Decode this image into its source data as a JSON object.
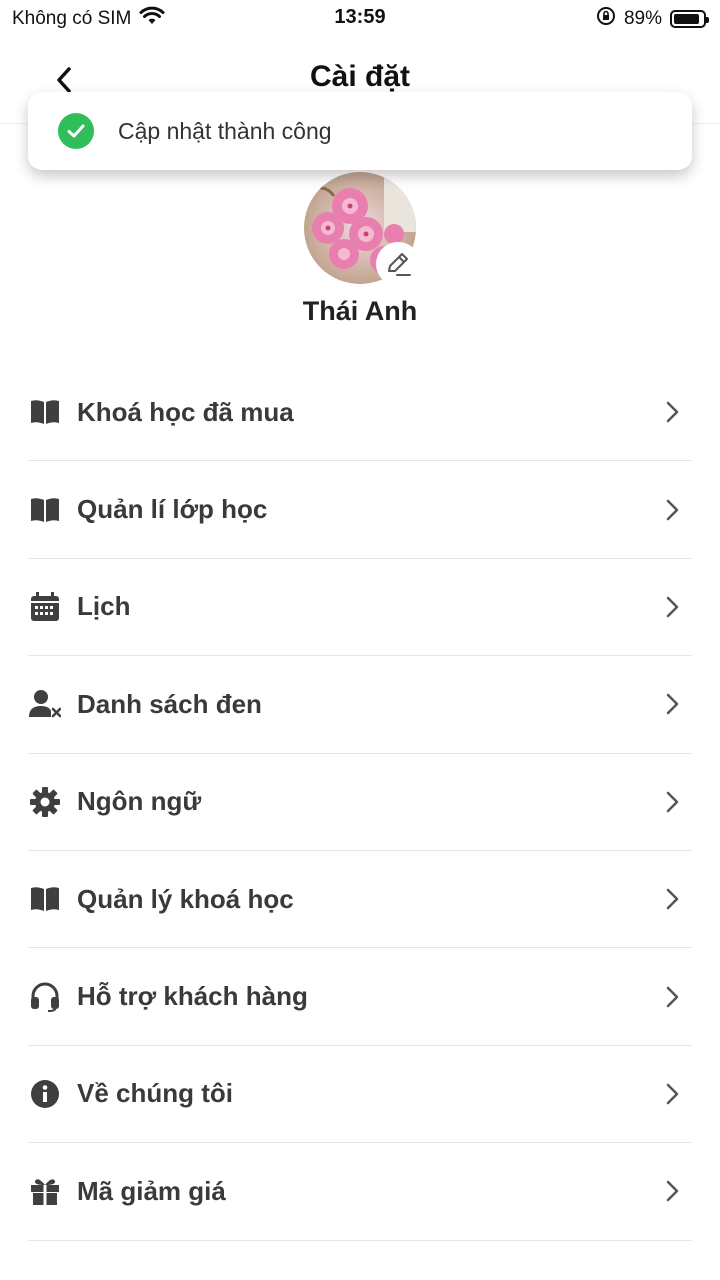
{
  "status_bar": {
    "carrier": "Không có SIM",
    "time": "13:59",
    "battery_percent": "89%",
    "battery_level": 0.89,
    "icons": [
      "wifi-icon",
      "orientation-lock-icon",
      "battery-icon"
    ]
  },
  "header": {
    "title": "Cài đặt",
    "back_icon": "chevron-left-icon"
  },
  "toast": {
    "message": "Cập nhật thành công",
    "icon": "check-circle-icon",
    "color": "#2fbe5a"
  },
  "profile": {
    "name": "Thái Anh",
    "avatar_icon": "cherry-blossom-photo",
    "edit_icon": "pencil-icon"
  },
  "menu": {
    "items": [
      {
        "label": "Khoá học đã mua",
        "icon": "book-icon"
      },
      {
        "label": "Quản lí lớp học",
        "icon": "book-icon"
      },
      {
        "label": "Lịch",
        "icon": "calendar-icon"
      },
      {
        "label": "Danh sách đen",
        "icon": "user-block-icon"
      },
      {
        "label": "Ngôn ngữ",
        "icon": "gear-icon"
      },
      {
        "label": "Quản lý khoá học",
        "icon": "book-icon"
      },
      {
        "label": "Hỗ trợ khách hàng",
        "icon": "headset-icon"
      },
      {
        "label": "Về chúng tôi",
        "icon": "info-icon"
      },
      {
        "label": "Mã giảm giá",
        "icon": "gift-icon"
      }
    ],
    "chevron_icon": "chevron-right-icon"
  },
  "colors": {
    "text_primary": "#222222",
    "menu_label": "#3a3a3a",
    "icon": "#3f3f3f",
    "divider": "#e6e6e6",
    "success": "#2fbe5a"
  }
}
